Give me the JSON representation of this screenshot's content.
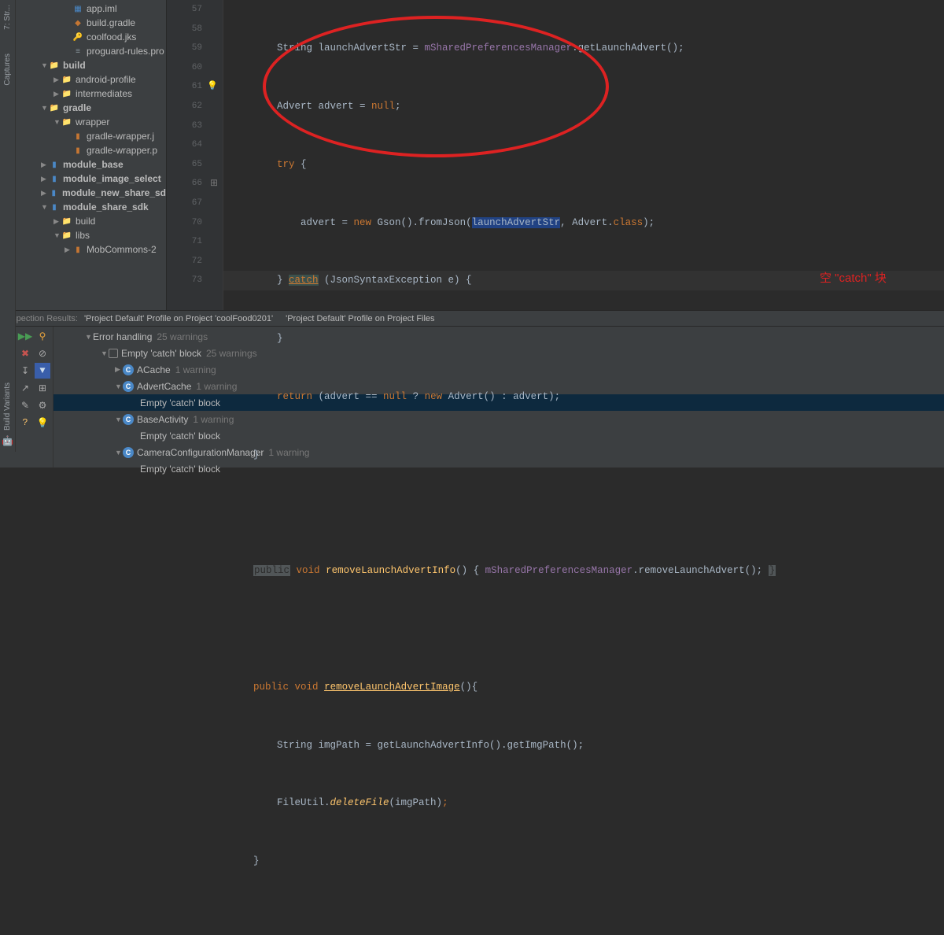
{
  "tool_stripes": {
    "left_top": [
      {
        "label": "7: Str...",
        "icon": "⊞"
      },
      {
        "label": "Captures",
        "icon": "📷"
      }
    ],
    "left_bottom_label": "Build Variants",
    "left_bottom_icon": "🤖"
  },
  "tree": [
    {
      "indent": 3,
      "arrow": "",
      "icon": "▦",
      "iconClass": "blue",
      "label": "app.iml"
    },
    {
      "indent": 3,
      "arrow": "",
      "icon": "◆",
      "iconClass": "orange",
      "label": "build.gradle"
    },
    {
      "indent": 3,
      "arrow": "",
      "icon": "🔑",
      "iconClass": "orange",
      "label": "coolfood.jks"
    },
    {
      "indent": 3,
      "arrow": "",
      "icon": "≡",
      "iconClass": "grey",
      "label": "proguard-rules.pro"
    },
    {
      "indent": 1,
      "arrow": "▼",
      "icon": "📁",
      "iconClass": "grey",
      "label": "build",
      "bold": true
    },
    {
      "indent": 2,
      "arrow": "▶",
      "icon": "📁",
      "iconClass": "grey",
      "label": "android-profile"
    },
    {
      "indent": 2,
      "arrow": "▶",
      "icon": "📁",
      "iconClass": "grey",
      "label": "intermediates"
    },
    {
      "indent": 1,
      "arrow": "▼",
      "icon": "📁",
      "iconClass": "grey",
      "label": "gradle",
      "bold": true
    },
    {
      "indent": 2,
      "arrow": "▼",
      "icon": "📁",
      "iconClass": "grey",
      "label": "wrapper"
    },
    {
      "indent": 3,
      "arrow": "",
      "icon": "▮",
      "iconClass": "orange",
      "label": "gradle-wrapper.j"
    },
    {
      "indent": 3,
      "arrow": "",
      "icon": "▮",
      "iconClass": "orange",
      "label": "gradle-wrapper.p"
    },
    {
      "indent": 1,
      "arrow": "▶",
      "icon": "▮",
      "iconClass": "blue",
      "label": "module_base",
      "bold": true
    },
    {
      "indent": 1,
      "arrow": "▶",
      "icon": "▮",
      "iconClass": "blue",
      "label": "module_image_select",
      "bold": true
    },
    {
      "indent": 1,
      "arrow": "▶",
      "icon": "▮",
      "iconClass": "blue",
      "label": "module_new_share_sd",
      "bold": true
    },
    {
      "indent": 1,
      "arrow": "▼",
      "icon": "▮",
      "iconClass": "blue",
      "label": "module_share_sdk",
      "bold": true
    },
    {
      "indent": 2,
      "arrow": "▶",
      "icon": "📁",
      "iconClass": "grey",
      "label": "build"
    },
    {
      "indent": 2,
      "arrow": "▼",
      "icon": "📁",
      "iconClass": "grey",
      "label": "libs"
    },
    {
      "indent": 3,
      "arrow": "▶",
      "icon": "▮",
      "iconClass": "orange",
      "label": "MobCommons-2"
    }
  ],
  "gutter": [
    {
      "n": "57"
    },
    {
      "n": "58"
    },
    {
      "n": "59"
    },
    {
      "n": "60"
    },
    {
      "n": "61",
      "bulb": true
    },
    {
      "n": "62"
    },
    {
      "n": "63"
    },
    {
      "n": "64"
    },
    {
      "n": "65"
    },
    {
      "n": "66",
      "collapse": true
    },
    {
      "n": "67"
    },
    {
      "n": "70"
    },
    {
      "n": "71"
    },
    {
      "n": "72"
    },
    {
      "n": "73"
    },
    {
      "n": ""
    }
  ],
  "code_lines": {
    "l57": {
      "a": "        String launchAdvertStr = ",
      "b": "mSharedPreferencesManager",
      "c": ".getLaunchAdvert();"
    },
    "l58": {
      "a": "        Advert advert = ",
      "b": "null",
      "c": ";"
    },
    "l59": {
      "a": "        ",
      "b": "try",
      "c": " {"
    },
    "l60": {
      "a": "            advert = ",
      "k": "new",
      "b": " Gson().fromJson(",
      "p": "launchAdvertStr",
      "c": ", Advert.",
      "d": "class",
      "e": ");"
    },
    "l61": {
      "a": "        } ",
      "b": "catch",
      "c": " (JsonSyntaxException e) {"
    },
    "l62": {
      "a": "        }"
    },
    "l63": {
      "a": "        ",
      "k": "return",
      "b": " (advert == ",
      "n": "null",
      "c": " ? ",
      "k2": "new",
      "d": " Advert() : advert);"
    },
    "l64": {
      "a": "    }"
    },
    "l65": {
      "a": ""
    },
    "l66": {
      "a": "    ",
      "p": "public",
      "b": " ",
      "k": "void",
      "c": " ",
      "m": "removeLaunchAdvertInfo",
      "d": "() { ",
      "f": "mSharedPreferencesManager",
      "e": ".removeLaunchAdvert(); ",
      "g": "}"
    },
    "l67": {
      "a": ""
    },
    "l70": {
      "a": "    ",
      "k": "public",
      "b": " ",
      "k2": "void",
      "c": " ",
      "m": "removeLaunchAdvertImage",
      "d": "(){"
    },
    "l71": {
      "a": "        String imgPath = getLaunchAdvertInfo().getImgPath();"
    },
    "l72": {
      "a": "        FileUtil.",
      "m": "deleteFile",
      "b": "(imgPath)",
      "c": ";"
    },
    "l73": {
      "a": "    }"
    }
  },
  "annotation": "空 \"catch\" 块",
  "inspection_header": {
    "title": "Inspection Results:",
    "crumb1": "'Project Default' Profile on Project 'coolFood0201'",
    "crumb2": "'Project Default' Profile on Project Files"
  },
  "inspect_tools": [
    {
      "glyph": "▶▶",
      "cls": "green",
      "name": "rerun-icon"
    },
    {
      "glyph": "⚲",
      "cls": "orange",
      "name": "bulb-icon"
    },
    {
      "glyph": "✖",
      "cls": "red",
      "name": "close-icon"
    },
    {
      "glyph": "⊘",
      "cls": "",
      "name": "suppress-icon"
    },
    {
      "glyph": "↧",
      "cls": "",
      "name": "expand-icon"
    },
    {
      "glyph": "▼",
      "cls": "blue-bg",
      "name": "filter-icon"
    },
    {
      "glyph": "↗",
      "cls": "",
      "name": "export-icon"
    },
    {
      "glyph": "⊞",
      "cls": "",
      "name": "group-icon"
    },
    {
      "glyph": "✎",
      "cls": "",
      "name": "edit-icon"
    },
    {
      "glyph": "⚙",
      "cls": "",
      "name": "settings-icon"
    },
    {
      "glyph": "?",
      "cls": "yellow",
      "name": "help-icon"
    },
    {
      "glyph": "💡",
      "cls": "",
      "name": "quickfix-icon"
    }
  ],
  "inspect_tree": [
    {
      "indent": 1,
      "arrow": "▼",
      "icon": "",
      "label": "Error handling",
      "count": "25 warnings"
    },
    {
      "indent": 2,
      "arrow": "▼",
      "icon": "item",
      "label": "Empty 'catch' block",
      "count": "25 warnings"
    },
    {
      "indent": 3,
      "arrow": "▶",
      "icon": "class",
      "label": "ACache",
      "count": "1 warning"
    },
    {
      "indent": 3,
      "arrow": "▼",
      "icon": "class",
      "label": "AdvertCache",
      "count": "1 warning"
    },
    {
      "indent": 4,
      "arrow": "",
      "icon": "",
      "label": "Empty 'catch' block",
      "count": "",
      "selected": true
    },
    {
      "indent": 3,
      "arrow": "▼",
      "icon": "class",
      "label": "BaseActivity",
      "count": "1 warning"
    },
    {
      "indent": 4,
      "arrow": "",
      "icon": "",
      "label": "Empty 'catch' block",
      "count": ""
    },
    {
      "indent": 3,
      "arrow": "▼",
      "icon": "class",
      "label": "CameraConfigurationManager",
      "count": "1 warning"
    },
    {
      "indent": 4,
      "arrow": "",
      "icon": "",
      "label": "Empty 'catch' block",
      "count": ""
    }
  ]
}
